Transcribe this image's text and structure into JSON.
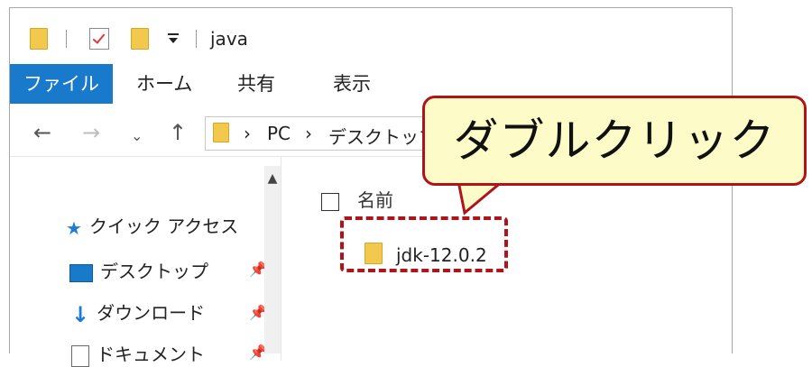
{
  "titlebar": {
    "title": "java"
  },
  "ribbon": {
    "tabs": [
      {
        "label": "ファイル",
        "active": true
      },
      {
        "label": "ホーム"
      },
      {
        "label": "共有"
      },
      {
        "label": "表示"
      }
    ]
  },
  "address": {
    "parts": [
      "PC",
      "デスクトップ"
    ]
  },
  "navpane": {
    "items": [
      {
        "label": "クイック アクセス",
        "icon": "star-icon"
      },
      {
        "label": "デスクトップ",
        "icon": "desktop-icon",
        "pinned": true
      },
      {
        "label": "ダウンロード",
        "icon": "download-icon",
        "pinned": true
      },
      {
        "label": "ドキュメント",
        "icon": "document-icon",
        "pinned": true
      }
    ]
  },
  "filelist": {
    "column_header": "名前",
    "items": [
      {
        "name": "jdk-12.0.2",
        "icon": "folder-icon"
      }
    ]
  },
  "callout": {
    "text": "ダブルクリック"
  },
  "colors": {
    "accent": "#1979ca",
    "highlight_border": "#b0141b",
    "callout_bg": "#fdfbc8",
    "folder": "#f2c94c"
  }
}
